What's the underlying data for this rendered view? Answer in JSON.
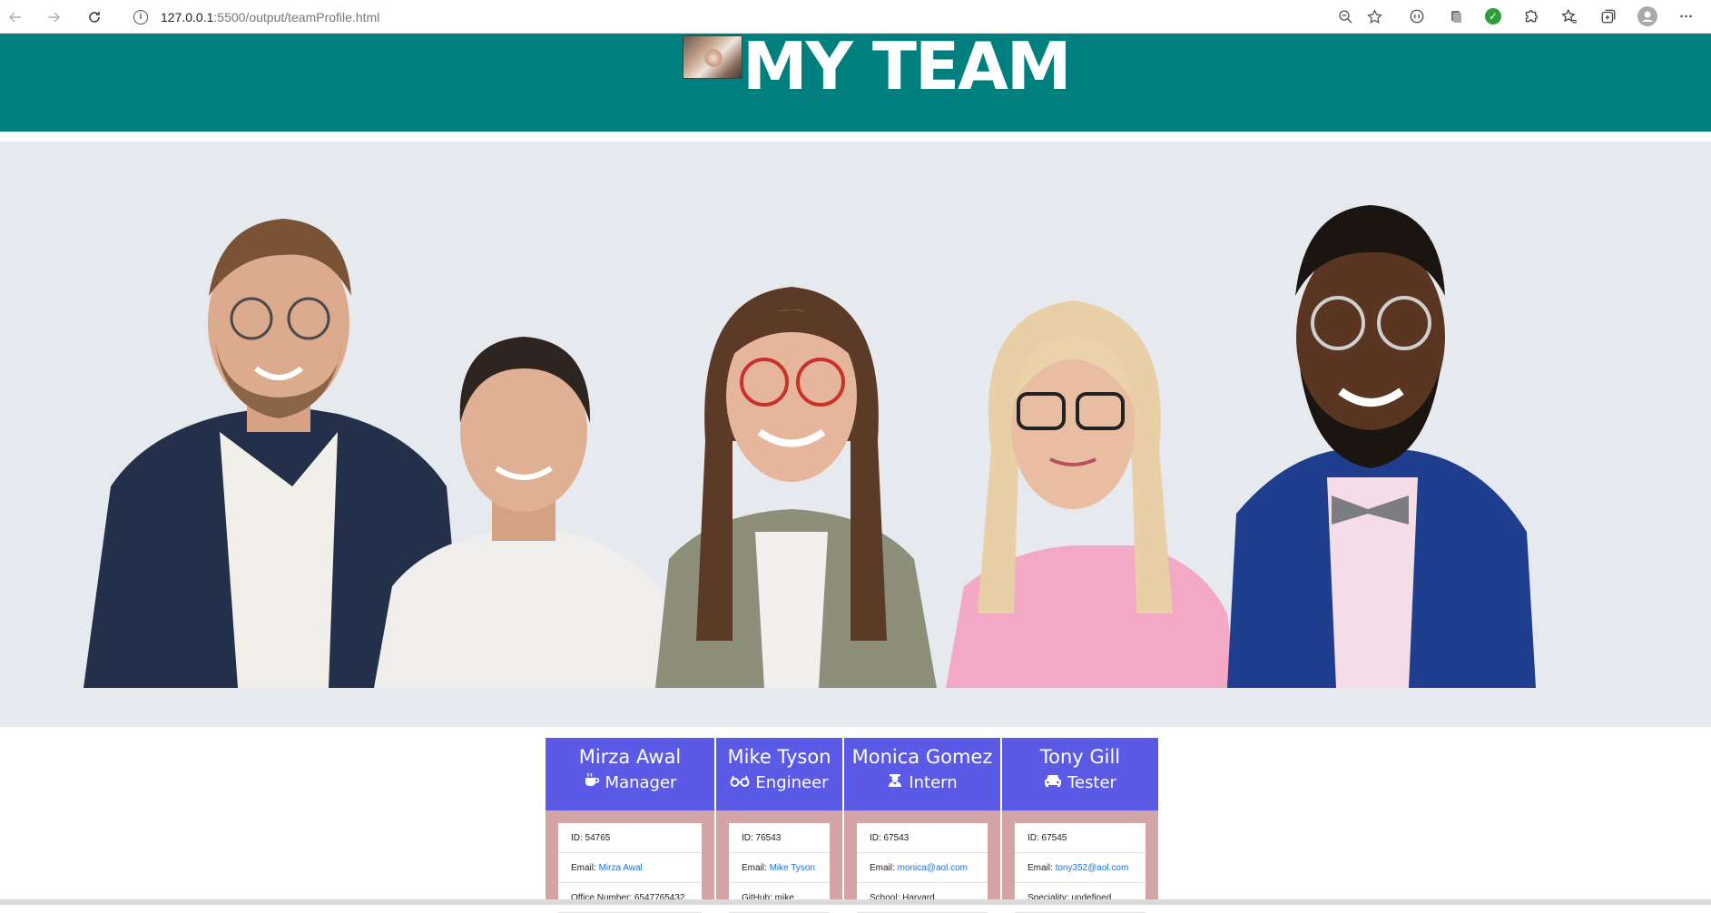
{
  "browser": {
    "url_host": "127.0.0.1",
    "url_rest": ":5500/output/teamProfile.html"
  },
  "header": {
    "title": "MY TEAM",
    "bg_color": "#007f7f"
  },
  "cards_accent": "#5a5ae6",
  "cards_body_color": "#d4a5a6",
  "team": [
    {
      "name": "Mirza Awal",
      "role": "Manager",
      "role_icon": "coffee-icon",
      "id": "ID: 54765",
      "email_label": "Email: ",
      "email": "Mirza Awal",
      "extra": "Office Number: 6547765432"
    },
    {
      "name": "Mike Tyson",
      "role": "Engineer",
      "role_icon": "glasses-icon",
      "id": "ID: 76543",
      "email_label": "Email: ",
      "email": "Mike Tyson",
      "extra": "GitHub: mike"
    },
    {
      "name": "Monica Gomez",
      "role": "Intern",
      "role_icon": "graduate-icon",
      "id": "ID: 67543",
      "email_label": "Email: ",
      "email": "monica@aol.com",
      "extra": "School: Harvard"
    },
    {
      "name": "Tony Gill",
      "role": "Tester",
      "role_icon": "car-icon",
      "id": "ID: 67545",
      "email_label": "Email: ",
      "email": "tony352@aol.com",
      "extra": "Speciality: undefined"
    }
  ]
}
